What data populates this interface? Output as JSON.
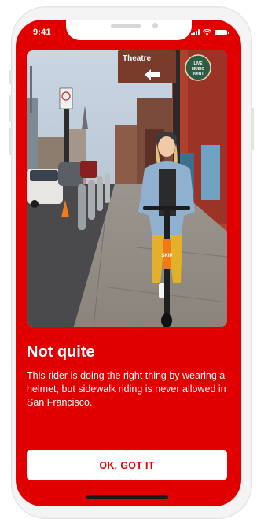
{
  "status_bar": {
    "time": "9:41",
    "icons": [
      "cellular-signal-icon",
      "wifi-icon",
      "battery-icon"
    ]
  },
  "photo": {
    "sign_theatre": "Theatre",
    "sign_live_music_top": "LIVE",
    "sign_live_music_mid": "MUSIC",
    "sign_live_music_bottom": "JOINT",
    "scooter_brand": "SKIP"
  },
  "feedback": {
    "title": "Not quite",
    "message": "This rider is doing the right thing by wearing a helmet, but sidewalk riding is never allowed in San Francisco."
  },
  "actions": {
    "confirm_label": "OK, GOT IT"
  },
  "colors": {
    "background": "#e00000",
    "button_text": "#e00000",
    "button_bg": "#ffffff"
  }
}
